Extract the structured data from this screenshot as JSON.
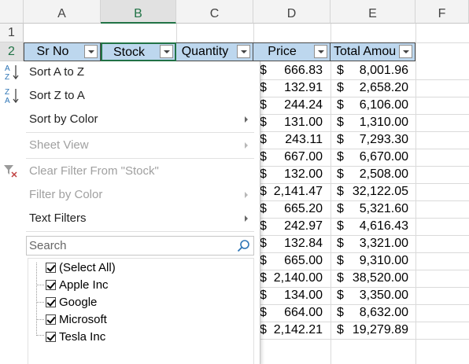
{
  "columns": [
    "A",
    "B",
    "C",
    "D",
    "E",
    "F"
  ],
  "rows": [
    "1",
    "2"
  ],
  "headers": {
    "sr_no": "Sr No",
    "stock": "Stock",
    "quantity": "Quantity",
    "price": "Price",
    "total": "Total Amou"
  },
  "currency_symbol": "$",
  "data_rows": [
    {
      "price": "666.83",
      "total": "8,001.96"
    },
    {
      "price": "132.91",
      "total": "2,658.20"
    },
    {
      "price": "244.24",
      "total": "6,106.00"
    },
    {
      "price": "131.00",
      "total": "1,310.00"
    },
    {
      "price": "243.11",
      "total": "7,293.30"
    },
    {
      "price": "667.00",
      "total": "6,670.00"
    },
    {
      "price": "132.00",
      "total": "2,508.00"
    },
    {
      "price": "2,141.47",
      "total": "32,122.05"
    },
    {
      "price": "665.20",
      "total": "5,321.60"
    },
    {
      "price": "242.97",
      "total": "4,616.43"
    },
    {
      "price": "132.84",
      "total": "3,321.00"
    },
    {
      "price": "665.00",
      "total": "9,310.00"
    },
    {
      "price": "2,140.00",
      "total": "38,520.00"
    },
    {
      "price": "134.00",
      "total": "3,350.00"
    },
    {
      "price": "664.00",
      "total": "8,632.00"
    },
    {
      "price": "2,142.21",
      "total": "19,279.89"
    }
  ],
  "filter_menu": {
    "sort_az": "Sort A to Z",
    "sort_za": "Sort Z to A",
    "sort_by_color": "Sort by Color",
    "sheet_view": "Sheet View",
    "clear_filter": "Clear Filter From \"Stock\"",
    "filter_by_color": "Filter by Color",
    "text_filters": "Text Filters",
    "search_placeholder": "Search",
    "items": [
      "(Select All)",
      "Apple Inc",
      "Google",
      "Microsoft",
      "Tesla Inc"
    ]
  },
  "colors": {
    "header_fill": "#bdd7ee",
    "selected_col": "#217346",
    "sort_icon_blue": "#2e75b6"
  },
  "icons": [
    "sort-az-icon",
    "sort-za-icon",
    "clear-filter-icon",
    "search-icon",
    "dropdown-arrow-icon",
    "checkbox-icon"
  ]
}
